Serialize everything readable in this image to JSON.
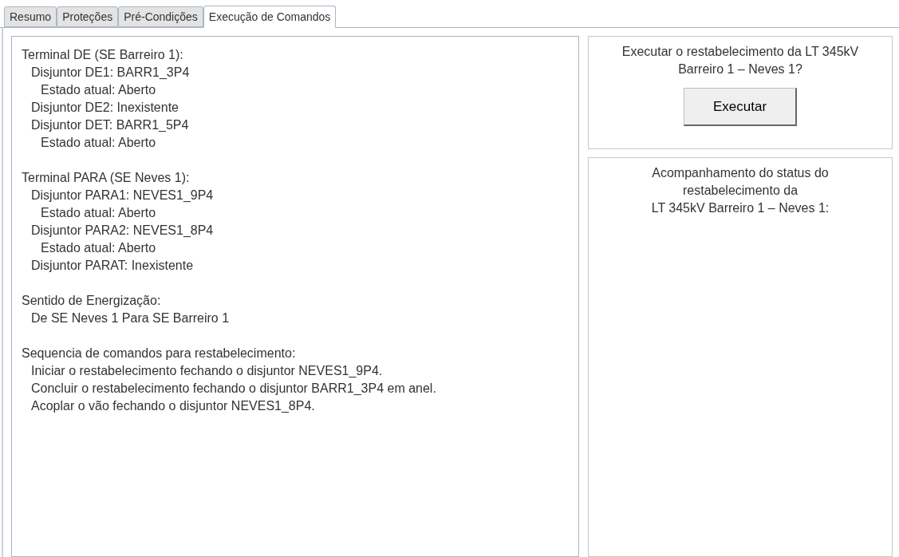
{
  "tabs": [
    {
      "label": "Resumo",
      "selected": false
    },
    {
      "label": "Proteções",
      "selected": false
    },
    {
      "label": "Pré-Condições",
      "selected": false
    },
    {
      "label": "Execução de Comandos",
      "selected": true
    }
  ],
  "details": {
    "sections": [
      {
        "text": "Terminal DE (SE Barreiro 1):",
        "children": [
          {
            "text": "Disjuntor DE1: BARR1_3P4",
            "children": [
              {
                "text": "Estado atual: Aberto"
              }
            ]
          },
          {
            "text": "Disjuntor DE2: Inexistente"
          },
          {
            "text": "Disjuntor DET: BARR1_5P4",
            "children": [
              {
                "text": "Estado atual: Aberto"
              }
            ]
          }
        ]
      },
      {
        "text": "Terminal PARA (SE Neves 1):",
        "children": [
          {
            "text": "Disjuntor PARA1: NEVES1_9P4",
            "children": [
              {
                "text": "Estado atual: Aberto"
              }
            ]
          },
          {
            "text": "Disjuntor PARA2: NEVES1_8P4",
            "children": [
              {
                "text": "Estado atual: Aberto"
              }
            ]
          },
          {
            "text": "Disjuntor PARAT: Inexistente"
          }
        ]
      },
      {
        "text": "Sentido de Energização:",
        "children": [
          {
            "text": "De SE Neves 1 Para SE Barreiro 1"
          }
        ]
      },
      {
        "text": "Sequencia de comandos para restabelecimento:",
        "children": [
          {
            "text": "Iniciar o restabelecimento fechando o disjuntor NEVES1_9P4."
          },
          {
            "text": "Concluir o restabelecimento fechando o disjuntor BARR1_3P4 em anel."
          },
          {
            "text": "Acoplar o vão fechando o disjuntor NEVES1_8P4."
          }
        ]
      }
    ]
  },
  "execute_panel": {
    "prompt_lines": [
      "Executar o restabelecimento da LT 345kV",
      "Barreiro 1 – Neves 1?"
    ],
    "button": "Executar"
  },
  "status_panel": {
    "title_lines": [
      "Acompanhamento do status do",
      "restabelecimento da",
      "LT 345kV Barreiro 1 – Neves 1:"
    ]
  }
}
